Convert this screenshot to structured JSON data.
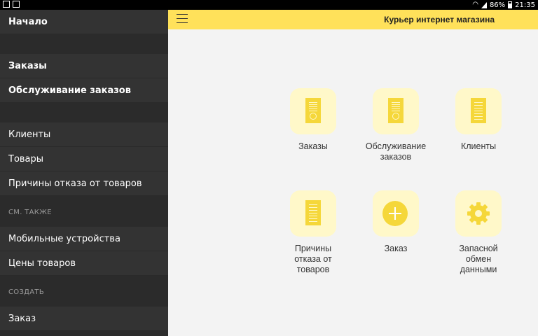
{
  "status": {
    "battery": "86%",
    "time": "21:35"
  },
  "app": {
    "title": "Курьер интернет магазина"
  },
  "sidebar": {
    "home": "Начало",
    "orders": "Заказы",
    "order_service": "Обслуживание заказов",
    "clients": "Клиенты",
    "goods": "Товары",
    "reject_reasons": "Причины отказа от товаров",
    "see_also": "СМ. ТАКЖЕ",
    "mobile_devices": "Мобильные устройства",
    "prices": "Цены товаров",
    "create": "СОЗДАТЬ",
    "new_order": "Заказ"
  },
  "tiles": {
    "orders": {
      "label": "Заказы",
      "icon": "document-check-icon"
    },
    "order_service": {
      "label": "Обслуживание заказов",
      "icon": "document-check-icon"
    },
    "clients": {
      "label": "Клиенты",
      "icon": "document-list-icon"
    },
    "reject_reasons": {
      "label": "Причины отказа от товаров",
      "icon": "document-list-icon"
    },
    "new_order": {
      "label": "Заказ",
      "icon": "plus-circle-icon"
    },
    "backup_exchange": {
      "label": "Запасной обмен данными",
      "icon": "gear-icon"
    }
  },
  "colors": {
    "accent": "#ffe15a",
    "icon": "#f5d73a",
    "tile_bg": "#fff8c9",
    "sidebar": "#333333"
  }
}
